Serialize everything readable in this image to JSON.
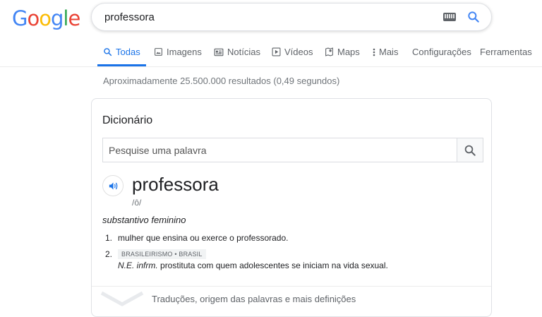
{
  "logo": {
    "letters": [
      "G",
      "o",
      "o",
      "g",
      "l",
      "e"
    ],
    "colors": [
      "#4285f4",
      "#ea4335",
      "#fbbc05",
      "#4285f4",
      "#34a853",
      "#ea4335"
    ]
  },
  "search": {
    "query": "professora"
  },
  "tabs": [
    {
      "label": "Todas",
      "icon": "search-icon",
      "active": true
    },
    {
      "label": "Imagens",
      "icon": "image-icon"
    },
    {
      "label": "Notícias",
      "icon": "news-icon"
    },
    {
      "label": "Vídeos",
      "icon": "play-icon"
    },
    {
      "label": "Maps",
      "icon": "map-pin-icon"
    },
    {
      "label": "Mais",
      "icon": "more-vert-icon"
    },
    {
      "label": "Configurações"
    },
    {
      "label": "Ferramentas"
    }
  ],
  "stats": "Aproximadamente 25.500.000 resultados (0,49 segundos)",
  "dictionary": {
    "title": "Dicionário",
    "search_placeholder": "Pesquise uma palavra",
    "word": "professora",
    "phonetic": "/ô/",
    "part_of_speech": "substantivo feminino",
    "definitions": [
      {
        "num": "1.",
        "text": "mulher que ensina ou exerce o professorado."
      },
      {
        "num": "2.",
        "tag": "BRASILEIRISMO • BRASIL",
        "label": "N.E. infrm.",
        "text": "prostituta com quem adolescentes se iniciam na vida sexual."
      }
    ],
    "more_link": "Traduções, origem das palavras e mais definições"
  },
  "colors": {
    "accent": "#1a73e8",
    "text": "#202124",
    "muted": "#70757a"
  }
}
